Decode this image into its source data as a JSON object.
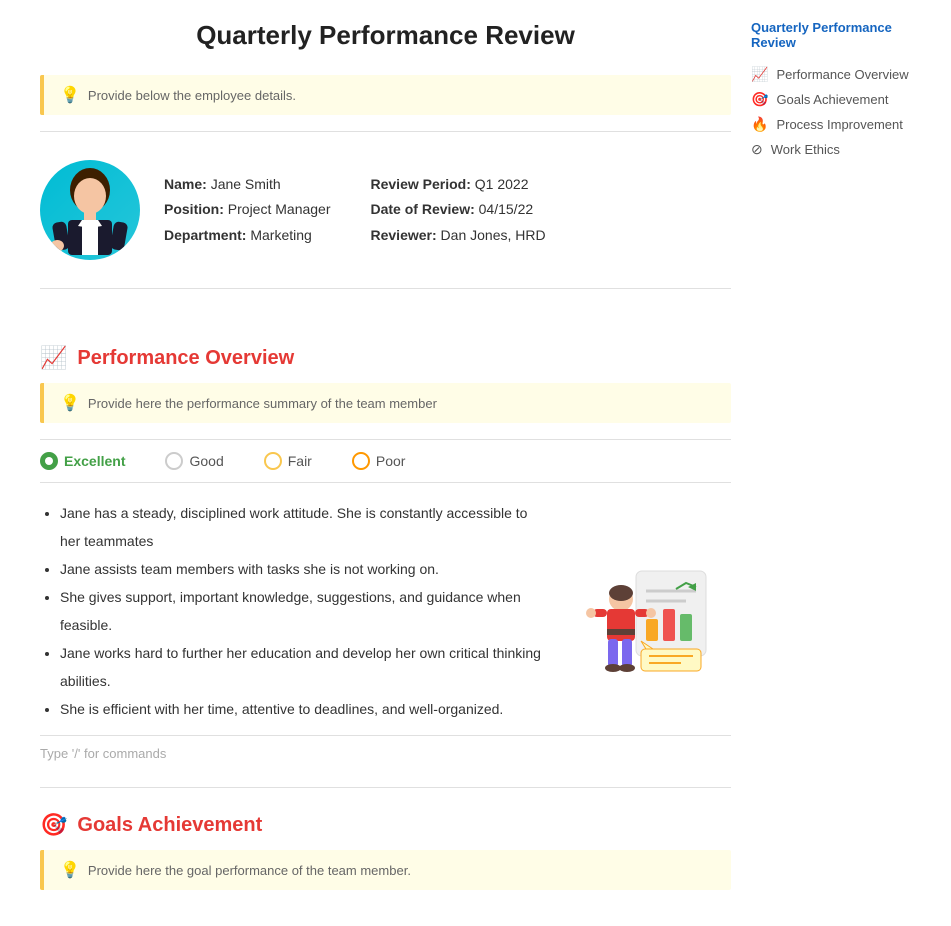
{
  "page": {
    "title": "Quarterly Performance Review"
  },
  "info_boxes": {
    "employee_hint": "Provide below the employee details.",
    "performance_hint": "Provide here the performance summary of the team member",
    "goals_hint": "Provide here the goal performance of the team member."
  },
  "employee": {
    "name_label": "Name:",
    "name_value": "Jane Smith",
    "position_label": "Position:",
    "position_value": "Project Manager",
    "department_label": "Department:",
    "department_value": "Marketing",
    "review_period_label": "Review Period:",
    "review_period_value": "Q1 2022",
    "date_label": "Date of Review:",
    "date_value": "04/15/22",
    "reviewer_label": "Reviewer:",
    "reviewer_value": "Dan Jones, HRD"
  },
  "sections": {
    "performance": {
      "icon": "📈",
      "title": "Performance Overview",
      "ratings": [
        {
          "label": "Excellent",
          "selected": true,
          "color": "green"
        },
        {
          "label": "Good",
          "selected": false,
          "color": "gray"
        },
        {
          "label": "Fair",
          "selected": false,
          "color": "yellow"
        },
        {
          "label": "Poor",
          "selected": false,
          "color": "orange"
        }
      ],
      "bullets": [
        "Jane has a steady, disciplined work attitude. She is constantly accessible to her teammates",
        "Jane assists team members with tasks she is not working on.",
        "She gives support, important knowledge, suggestions, and guidance when feasible.",
        "Jane works hard to further her education and develop her own critical thinking abilities.",
        "She is efficient with her time, attentive to deadlines, and well-organized."
      ],
      "command_hint": "Type '/' for commands"
    },
    "goals": {
      "icon": "🎯",
      "title": "Goals Achievement"
    }
  },
  "sidebar": {
    "title": "Quarterly Performance Review",
    "items": [
      {
        "icon": "📈",
        "label": "Performance Overview"
      },
      {
        "icon": "🎯",
        "label": "Goals Achievement"
      },
      {
        "icon": "🔥",
        "label": "Process Improvement"
      },
      {
        "icon": "⊘",
        "label": "Work Ethics"
      }
    ]
  }
}
